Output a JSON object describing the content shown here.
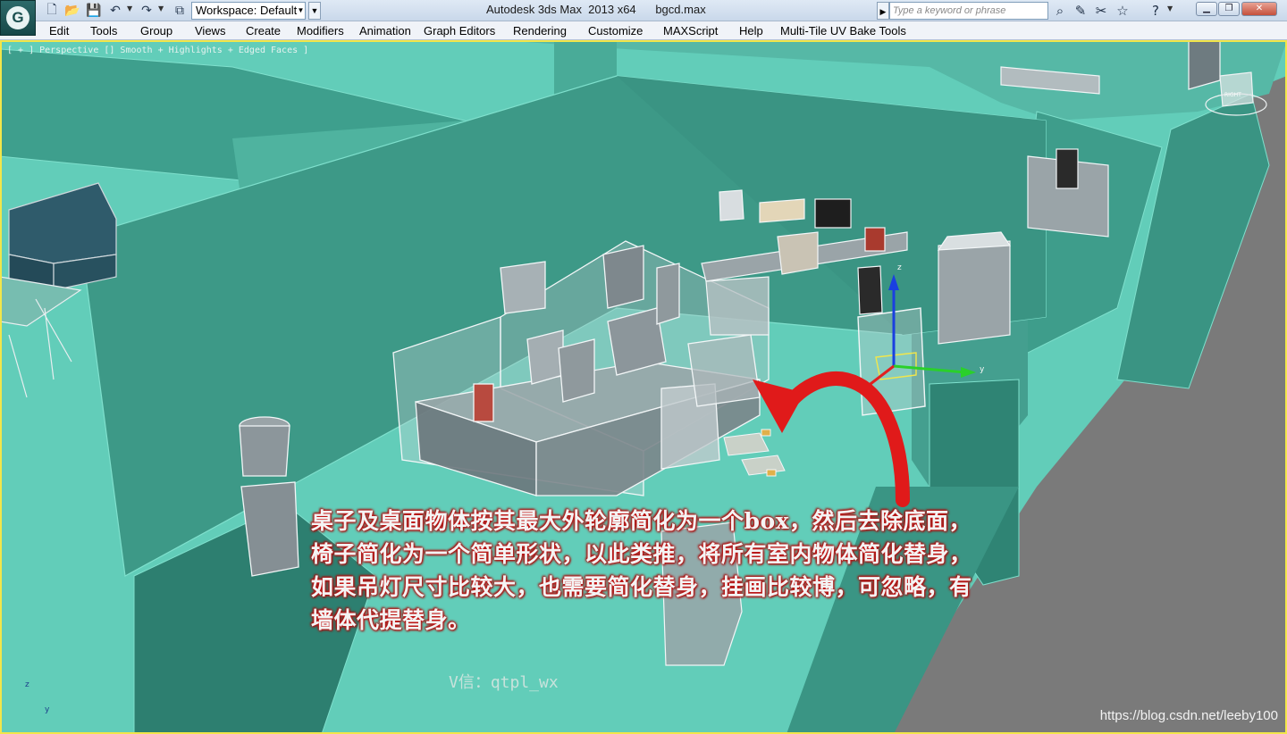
{
  "window": {
    "title": "Autodesk 3ds Max  2013 x64      bgcd.max",
    "app_logo": "3ds-max-logo",
    "workspace_value": "Workspace: Default",
    "search_placeholder": "Type a keyword or phrase",
    "quick_access_icons": [
      "new-file-icon",
      "open-folder-icon",
      "save-icon",
      "undo-icon",
      "redo-icon",
      "project-folder-icon"
    ],
    "search_tools_icons": [
      "binoculars-icon",
      "communication-icon",
      "favorites-icon",
      "star-icon",
      "help-icon"
    ],
    "window_buttons": [
      "minimize",
      "restore",
      "close"
    ]
  },
  "menu": {
    "items": [
      "Edit",
      "Tools",
      "Group",
      "Views",
      "Create",
      "Modifiers",
      "Animation",
      "Graph Editors",
      "Rendering",
      "Customize",
      "MAXScript",
      "Help",
      "Multi-Tile UV Bake Tools"
    ]
  },
  "viewport": {
    "label": "[ + ] Perspective [] Smooth + Highlights + Edged Faces ]",
    "viewcube_face": "RIGHT",
    "gizmo_labels": {
      "z": "z",
      "y": "y"
    },
    "world_axis": {
      "z": "z",
      "y": "y"
    },
    "annotation": "桌子及桌面物体按其最大外轮廓简化为一个box，然后去除底面，椅子简化为一个简单形状，以此类推，将所有室内物体简化替身，如果吊灯尺寸比较大，也需要简化替身，挂画比较博，可忽略，有墙体代提替身。",
    "wechat": "V信：qtpl_wx",
    "watermark": "https://blog.csdn.net/leeby100",
    "colors": {
      "floor": "#5fc9b6",
      "wall": "#3a9a88",
      "wall_dark": "#2e8474",
      "outside": "#7a7a7a",
      "arrow": "#e01a1a",
      "selection": "#f2e64a",
      "object_gray": "#8f9aa0"
    }
  }
}
